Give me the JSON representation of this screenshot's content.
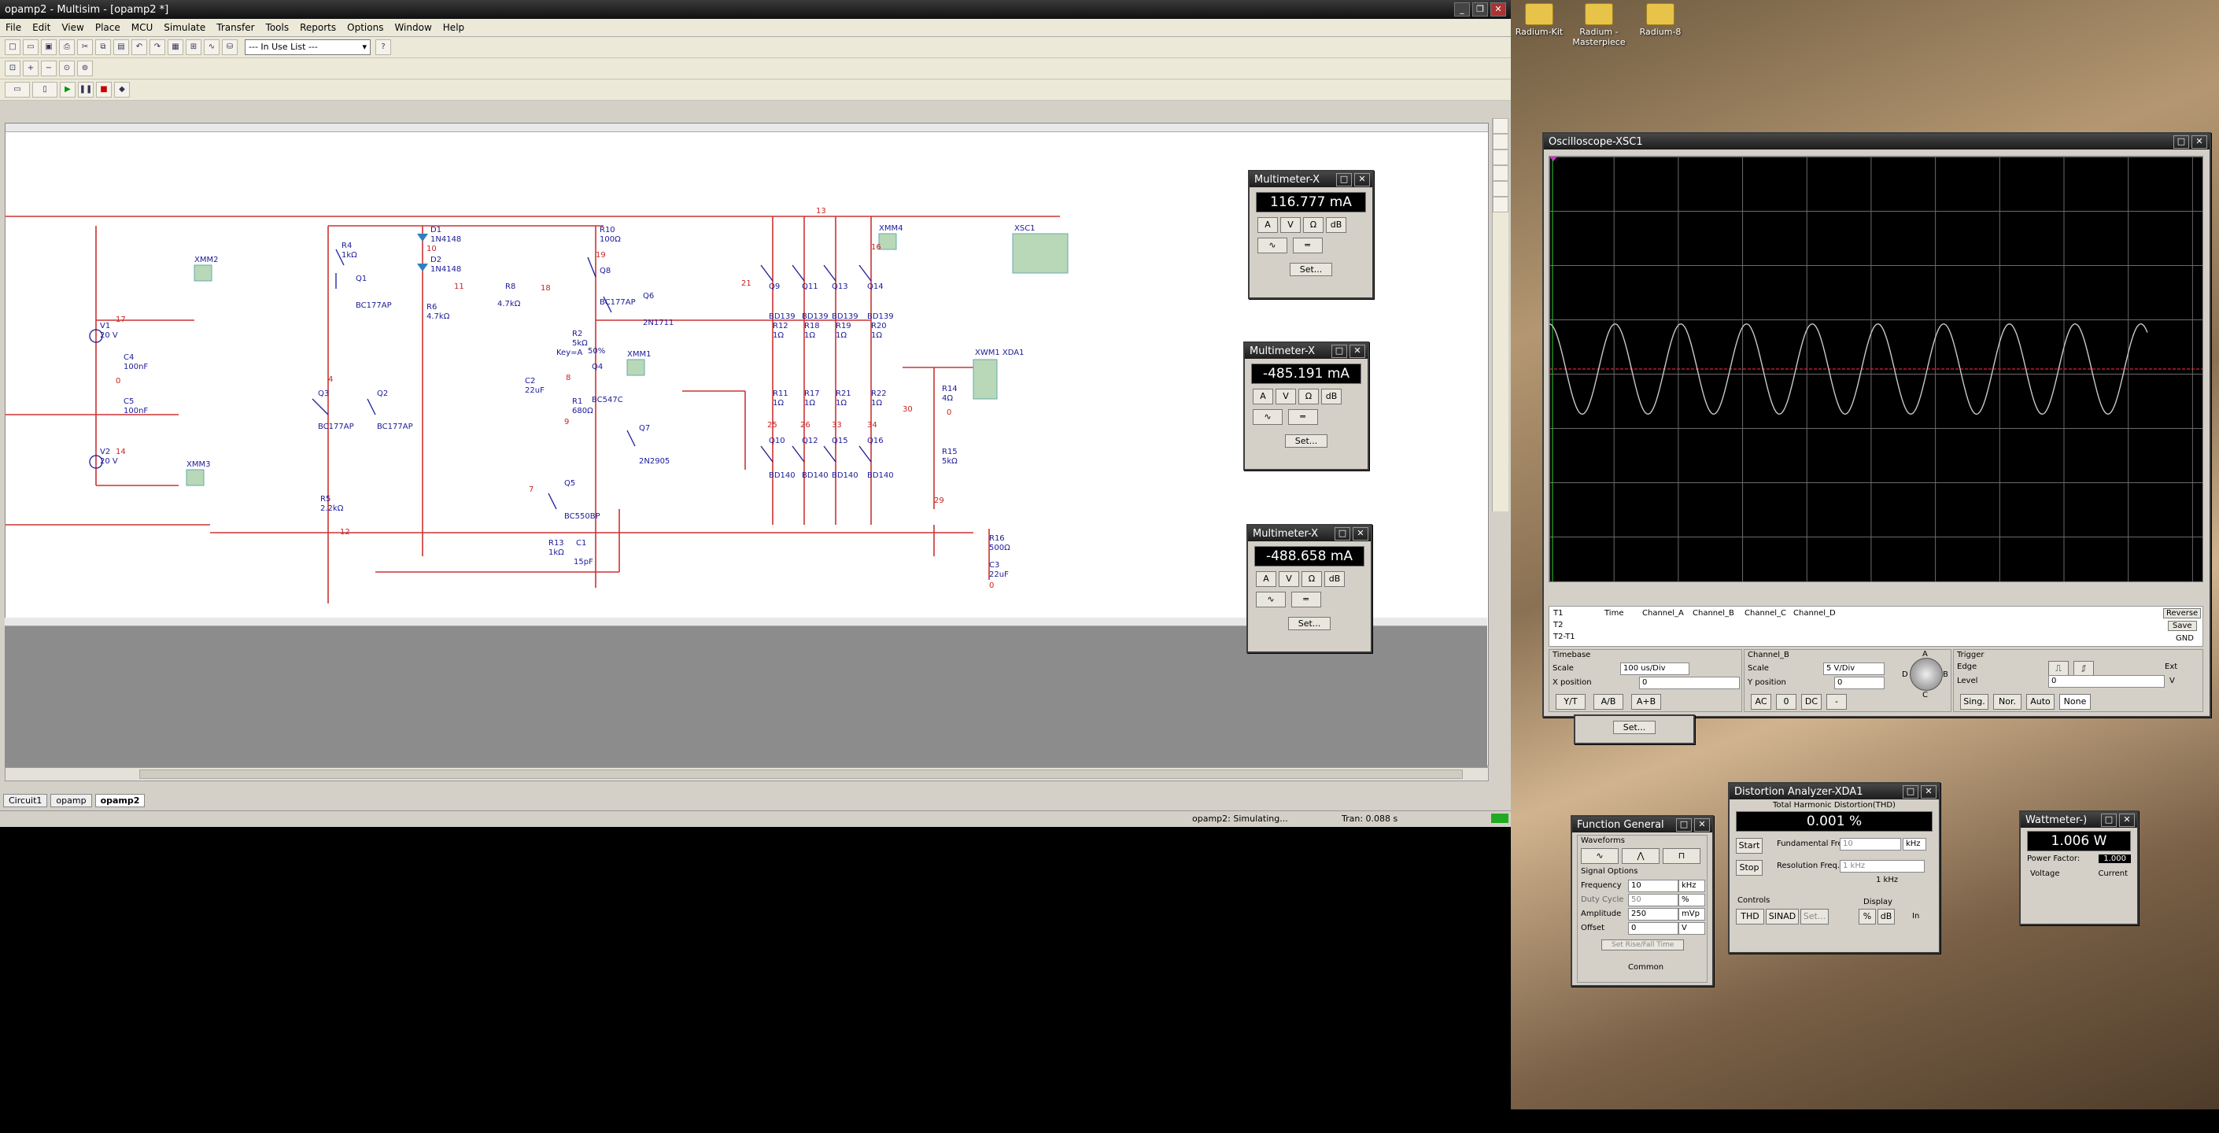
{
  "main_window": {
    "title": "opamp2 - Multisim - [opamp2 *]",
    "menu": [
      "File",
      "Edit",
      "View",
      "Place",
      "MCU",
      "Simulate",
      "Transfer",
      "Tools",
      "Reports",
      "Options",
      "Window",
      "Help"
    ],
    "in_use_list": "--- In Use List ---",
    "tabs": [
      "Circuit1",
      "opamp",
      "opamp2"
    ],
    "status": {
      "message": "opamp2: Simulating...",
      "tran": "Tran: 0.088 s"
    }
  },
  "schematic": {
    "components": [
      {
        "ref": "XMM2"
      },
      {
        "ref": "XMM3"
      },
      {
        "ref": "XMM4"
      },
      {
        "ref": "XMM1"
      },
      {
        "ref": "XSC1"
      },
      {
        "ref": "XWM1 XDA1"
      },
      {
        "ref": "V1",
        "value": "20 V"
      },
      {
        "ref": "V2",
        "value": "20 V"
      },
      {
        "ref": "C4",
        "value": "100nF"
      },
      {
        "ref": "C5",
        "value": "100nF"
      },
      {
        "ref": "R4",
        "value": "1kΩ"
      },
      {
        "ref": "Q1",
        "value": "BC177AP"
      },
      {
        "ref": "D1",
        "value": "1N4148"
      },
      {
        "ref": "D2",
        "value": "1N4148"
      },
      {
        "ref": "R10",
        "value": "100Ω"
      },
      {
        "ref": "Q8",
        "value": "BC177AP"
      },
      {
        "ref": "Q6",
        "value": "2N1711"
      },
      {
        "ref": "R8",
        "value": "4.7kΩ"
      },
      {
        "ref": "R6",
        "value": "4.7kΩ"
      },
      {
        "ref": "R2",
        "value": "5kΩ"
      },
      {
        "ref": "R1",
        "value": "680Ω"
      },
      {
        "ref": "Q4",
        "value": "BC547C"
      },
      {
        "ref": "C2",
        "value": "22uF"
      },
      {
        "ref": "Q3",
        "value": "BC177AP"
      },
      {
        "ref": "Q2",
        "value": "BC177AP"
      },
      {
        "ref": "R5",
        "value": "2.2kΩ"
      },
      {
        "ref": "Q5",
        "value": "BC550BP"
      },
      {
        "ref": "Q7",
        "value": "2N2905"
      },
      {
        "ref": "R13",
        "value": "1kΩ"
      },
      {
        "ref": "C1",
        "value": "15pF"
      },
      {
        "ref": "Q9",
        "value": "BD139"
      },
      {
        "ref": "Q11",
        "value": "BD139"
      },
      {
        "ref": "Q13",
        "value": "BD139"
      },
      {
        "ref": "Q14",
        "value": "BD139"
      },
      {
        "ref": "R12",
        "value": "1Ω"
      },
      {
        "ref": "R18",
        "value": "1Ω"
      },
      {
        "ref": "R19",
        "value": "1Ω"
      },
      {
        "ref": "R20",
        "value": "1Ω"
      },
      {
        "ref": "R11",
        "value": "1Ω"
      },
      {
        "ref": "R17",
        "value": "1Ω"
      },
      {
        "ref": "R21",
        "value": "1Ω"
      },
      {
        "ref": "R22",
        "value": "1Ω"
      },
      {
        "ref": "Q10",
        "value": "BD140"
      },
      {
        "ref": "Q12",
        "value": "BD140"
      },
      {
        "ref": "Q15",
        "value": "BD140"
      },
      {
        "ref": "Q16",
        "value": "BD140"
      },
      {
        "ref": "R14",
        "value": "4Ω"
      },
      {
        "ref": "R15",
        "value": "5kΩ"
      },
      {
        "ref": "R16",
        "value": "500Ω"
      },
      {
        "ref": "C3",
        "value": "22uF"
      }
    ],
    "net_labels": [
      "13",
      "17",
      "0",
      "14",
      "16",
      "10",
      "19",
      "11",
      "18",
      "21",
      "4",
      "9",
      "8",
      "7",
      "12",
      "25",
      "26",
      "33",
      "34",
      "30",
      "29",
      "0",
      "0"
    ],
    "key_label": "Key=A",
    "pot_percent": "50%"
  },
  "multimeters": [
    {
      "title": "Multimeter-X",
      "reading": "116.777 mA"
    },
    {
      "title": "Multimeter-X",
      "reading": "-485.191 mA"
    },
    {
      "title": "Multimeter-X",
      "reading": "-488.658 mA"
    }
  ],
  "multimeter_buttons": [
    "A",
    "V",
    "Ω",
    "dB"
  ],
  "set_label": "Set...",
  "oscilloscope": {
    "title": "Oscilloscope-XSC1",
    "cursor_headers": [
      "Time",
      "Channel_A",
      "Channel_B",
      "Channel_C",
      "Channel_D"
    ],
    "cursor_rows": [
      "T1",
      "T2",
      "T2-T1"
    ],
    "reverse_label": "Reverse",
    "save_label": "Save",
    "gnd_label": "GND",
    "timebase": {
      "label": "Timebase",
      "scale_label": "Scale",
      "scale": "100 us/Div",
      "xpos_label": "X position",
      "xpos": "0",
      "buttons": [
        "Y/T",
        "A/B",
        "A+B"
      ]
    },
    "channel": {
      "label": "Channel_B",
      "scale_label": "Scale",
      "scale": "5 V/Div",
      "ypos_label": "Y position",
      "ypos": "0",
      "buttons": [
        "AC",
        "0",
        "DC",
        "-"
      ]
    },
    "knob_labels": [
      "A",
      "B",
      "C",
      "D"
    ],
    "trigger": {
      "label": "Trigger",
      "edge_label": "Edge",
      "level_label": "Level",
      "level": "0",
      "level_unit": "V",
      "ext_label": "Ext",
      "buttons": [
        "Sing.",
        "Nor.",
        "Auto",
        "None"
      ]
    },
    "waveform": {
      "type": "sine",
      "cycles": 9.1,
      "amplitude_div": 0.85,
      "offset_div": 0.0,
      "color": "#c8c8c8"
    }
  },
  "function_generator": {
    "title": "Function General",
    "waveforms_label": "Waveforms",
    "signal_options_label": "Signal Options",
    "fields": [
      {
        "label": "Frequency",
        "value": "10",
        "unit": "kHz"
      },
      {
        "label": "Duty Cycle",
        "value": "50",
        "unit": "%"
      },
      {
        "label": "Amplitude",
        "value": "250",
        "unit": "mVp"
      },
      {
        "label": "Offset",
        "value": "0",
        "unit": "V"
      }
    ],
    "rise_fall_label": "Set Rise/Fall Time",
    "common_label": "Common"
  },
  "distortion_analyzer": {
    "title": "Distortion Analyzer-XDA1",
    "heading": "Total Harmonic Distortion(THD)",
    "reading": "0.001 %",
    "start_label": "Start",
    "stop_label": "Stop",
    "fundamental_label": "Fundamental Freq.",
    "fundamental_value": "10",
    "fundamental_unit": "kHz",
    "resolution_label": "Resolution Freq.",
    "resolution_value": "1 kHz",
    "resolution_display": "1 kHz",
    "controls_label": "Controls",
    "control_buttons": [
      "THD",
      "SINAD",
      "Set..."
    ],
    "display_label": "Display",
    "display_buttons": [
      "%",
      "dB"
    ],
    "in_label": "In"
  },
  "wattmeter": {
    "title": "Wattmeter-)",
    "reading": "1.006 W",
    "pf_label": "Power Factor:",
    "pf_value": "1.000",
    "voltage_label": "Voltage",
    "current_label": "Current"
  },
  "desktop_icons": [
    "Radium-Kit",
    "Radium - Masterpiece",
    "Radium-8"
  ]
}
